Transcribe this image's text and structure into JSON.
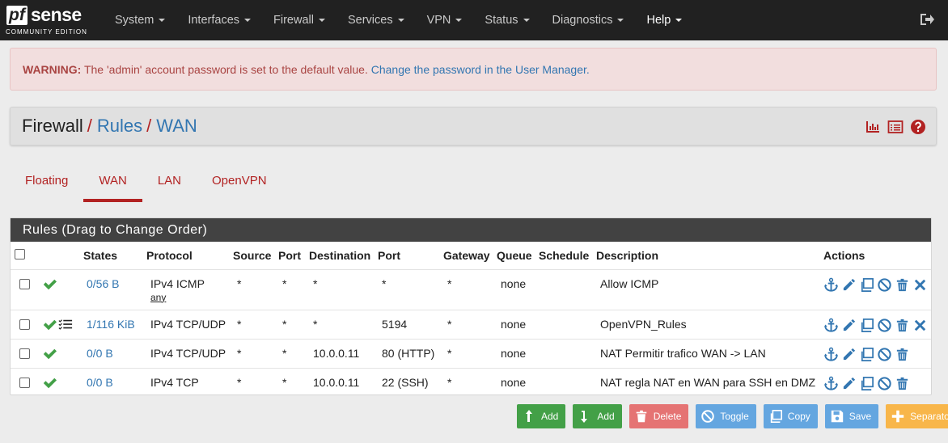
{
  "brand": {
    "logo_pf": "pf",
    "logo_sense": "sense",
    "edition": "COMMUNITY EDITION"
  },
  "nav": [
    "System",
    "Interfaces",
    "Firewall",
    "Services",
    "VPN",
    "Status",
    "Diagnostics",
    "Help"
  ],
  "alert": {
    "label": "WARNING:",
    "text": "The 'admin' account password is set to the default value.",
    "link": "Change the password in the User Manager."
  },
  "breadcrumb": {
    "home": "Firewall",
    "rules": "Rules",
    "current": "WAN"
  },
  "tabs": [
    "Floating",
    "WAN",
    "LAN",
    "OpenVPN"
  ],
  "panel": {
    "title": "Rules (Drag to Change Order)"
  },
  "columns": [
    "States",
    "Protocol",
    "Source",
    "Port",
    "Destination",
    "Port",
    "Gateway",
    "Queue",
    "Schedule",
    "Description",
    "Actions"
  ],
  "rows": [
    {
      "states": "0/56 B",
      "protocol": "IPv4 ICMP",
      "protocol_sub": "any",
      "source": "*",
      "sport": "*",
      "dest": "*",
      "dport": "*",
      "gateway": "*",
      "queue": "none",
      "schedule": "",
      "description": "Allow ICMP"
    },
    {
      "states": "1/116 KiB",
      "protocol": "IPv4 TCP/UDP",
      "protocol_sub": "",
      "source": "*",
      "sport": "*",
      "dest": "*",
      "dport": "5194",
      "gateway": "*",
      "queue": "none",
      "schedule": "",
      "description": "OpenVPN_Rules"
    },
    {
      "states": "0/0 B",
      "protocol": "IPv4 TCP/UDP",
      "protocol_sub": "",
      "source": "*",
      "sport": "*",
      "dest": "10.0.0.11",
      "dport": "80 (HTTP)",
      "gateway": "*",
      "queue": "none",
      "schedule": "",
      "description": "NAT Permitir trafico WAN -> LAN"
    },
    {
      "states": "0/0 B",
      "protocol": "IPv4 TCP",
      "protocol_sub": "",
      "source": "*",
      "sport": "*",
      "dest": "10.0.0.11",
      "dport": "22 (SSH)",
      "gateway": "*",
      "queue": "none",
      "schedule": "",
      "description": "NAT regla NAT en WAN para SSH en DMZ"
    }
  ],
  "buttons": {
    "add_top": "Add",
    "add_bottom": "Add",
    "delete": "Delete",
    "toggle": "Toggle",
    "copy": "Copy",
    "save": "Save",
    "separator": "Separator"
  },
  "colors": {
    "navbar": "#212121",
    "accent_red": "#b22222",
    "link_blue": "#3276b1",
    "pass_green": "#43a047"
  }
}
